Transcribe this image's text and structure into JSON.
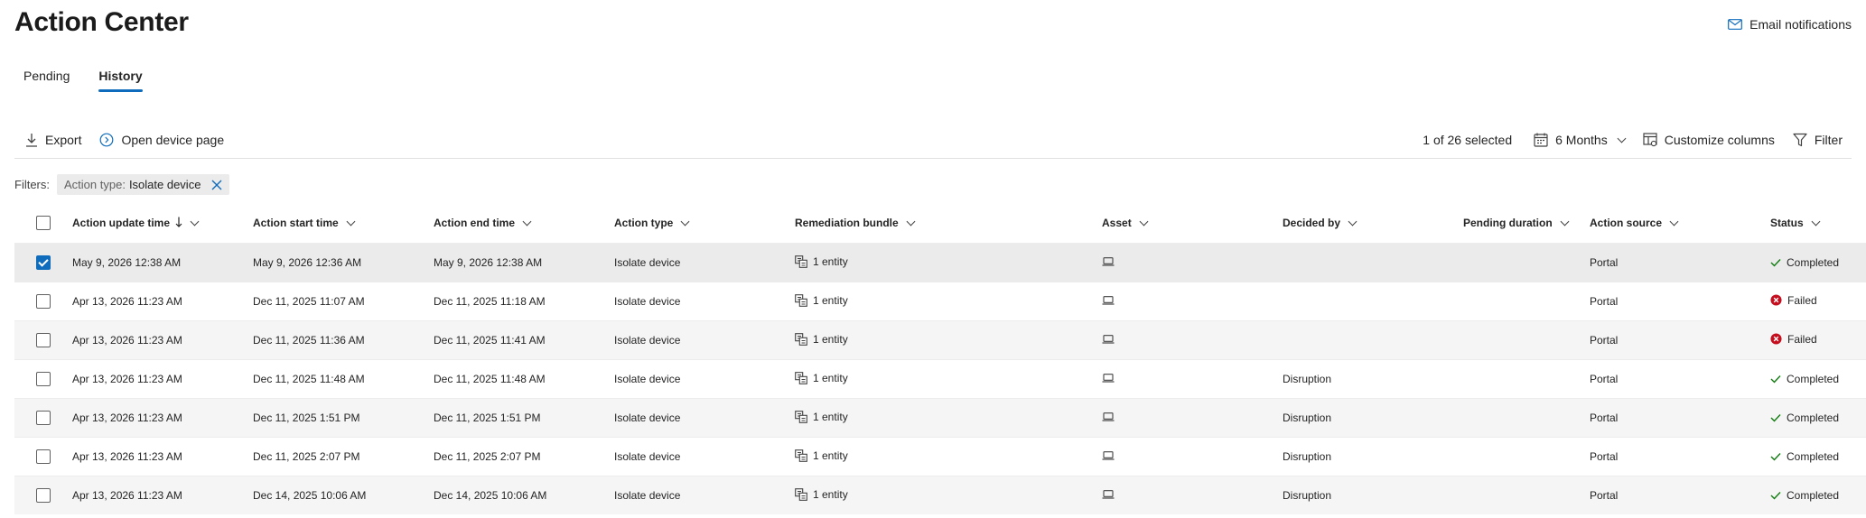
{
  "page": {
    "title": "Action Center",
    "email_label": "Email notifications"
  },
  "tabs": [
    {
      "label": "Pending",
      "active": false
    },
    {
      "label": "History",
      "active": true
    }
  ],
  "toolbar": {
    "export_label": "Export",
    "open_device_label": "Open device page",
    "selected_text": "1 of 26 selected",
    "time_range": "6 Months",
    "customize_label": "Customize columns",
    "filter_label": "Filter"
  },
  "filters": {
    "label": "Filters:",
    "pill_key": "Action type:",
    "pill_value": "Isolate device"
  },
  "columns": [
    "Action update time",
    "Action start time",
    "Action end time",
    "Action type",
    "Remediation bundle",
    "Asset",
    "Decided by",
    "Pending duration",
    "Action source",
    "Status"
  ],
  "sort_column": "Action update time",
  "rows": [
    {
      "selected": true,
      "update": "May 9, 2026 12:38 AM",
      "start": "May 9, 2026 12:36 AM",
      "end": "May 9, 2026 12:38 AM",
      "type": "Isolate device",
      "bundle": "1 entity",
      "decided": "",
      "pending": "",
      "source": "Portal",
      "status": "Completed"
    },
    {
      "selected": false,
      "update": "Apr 13, 2026 11:23 AM",
      "start": "Dec 11, 2025 11:07 AM",
      "end": "Dec 11, 2025 11:18 AM",
      "type": "Isolate device",
      "bundle": "1 entity",
      "decided": "",
      "pending": "",
      "source": "Portal",
      "status": "Failed"
    },
    {
      "selected": false,
      "update": "Apr 13, 2026 11:23 AM",
      "start": "Dec 11, 2025 11:36 AM",
      "end": "Dec 11, 2025 11:41 AM",
      "type": "Isolate device",
      "bundle": "1 entity",
      "decided": "",
      "pending": "",
      "source": "Portal",
      "status": "Failed"
    },
    {
      "selected": false,
      "update": "Apr 13, 2026 11:23 AM",
      "start": "Dec 11, 2025 11:48 AM",
      "end": "Dec 11, 2025 11:48 AM",
      "type": "Isolate device",
      "bundle": "1 entity",
      "decided": "Disruption",
      "pending": "",
      "source": "Portal",
      "status": "Completed"
    },
    {
      "selected": false,
      "update": "Apr 13, 2026 11:23 AM",
      "start": "Dec 11, 2025 1:51 PM",
      "end": "Dec 11, 2025 1:51 PM",
      "type": "Isolate device",
      "bundle": "1 entity",
      "decided": "Disruption",
      "pending": "",
      "source": "Portal",
      "status": "Completed"
    },
    {
      "selected": false,
      "update": "Apr 13, 2026 11:23 AM",
      "start": "Dec 11, 2025 2:07 PM",
      "end": "Dec 11, 2025 2:07 PM",
      "type": "Isolate device",
      "bundle": "1 entity",
      "decided": "Disruption",
      "pending": "",
      "source": "Portal",
      "status": "Completed"
    },
    {
      "selected": false,
      "update": "Apr 13, 2026 11:23 AM",
      "start": "Dec 14, 2025 10:06 AM",
      "end": "Dec 14, 2025 10:06 AM",
      "type": "Isolate device",
      "bundle": "1 entity",
      "decided": "Disruption",
      "pending": "",
      "source": "Portal",
      "status": "Completed"
    }
  ],
  "colors": {
    "accent": "#0f6cbd",
    "completed": "#107c10",
    "failed": "#c50f1f"
  }
}
